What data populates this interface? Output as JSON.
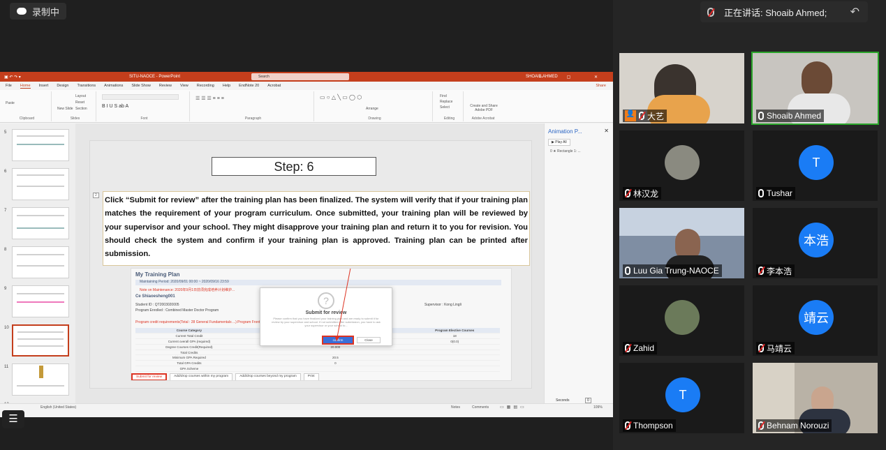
{
  "recording": {
    "label": "录制中"
  },
  "speaking": {
    "label": "正在讲话: Shoaib Ahmed;"
  },
  "ppt": {
    "title": "SITU-NAOCE - PowerPoint",
    "search": "Search",
    "user": "SHOAIB AHMED",
    "user_initials": "SA",
    "menu": [
      "File",
      "Home",
      "Insert",
      "Design",
      "Transitions",
      "Animations",
      "Slide Show",
      "Review",
      "View",
      "Recording",
      "Help",
      "EndNote 20",
      "Acrobat"
    ],
    "share": "Share",
    "ribbon_groups": [
      "Clipboard",
      "Slides",
      "Font",
      "Paragraph",
      "Drawing",
      "Editing",
      "Adobe Acrobat"
    ],
    "ribbon_items": {
      "paste": "Paste",
      "new_slide": "New Slide",
      "layout": "Layout",
      "reset": "Reset",
      "section": "Section",
      "find": "Find",
      "replace": "Replace",
      "select": "Select",
      "arrange": "Arrange",
      "adobe": "Create and Share Adobe PDF"
    },
    "thumbs": [
      {
        "num": "5"
      },
      {
        "num": "6"
      },
      {
        "num": "7"
      },
      {
        "num": "8"
      },
      {
        "num": "9"
      },
      {
        "num": "10",
        "selected": true
      },
      {
        "num": "11"
      },
      {
        "num": "12"
      }
    ],
    "slide": {
      "step": "Step: 6",
      "marker": "2",
      "paragraph": "Click “Submit for review” after the training plan has been finalized. The system will verify that if your training plan matches the requirement of your program curriculum. Once submitted, your training plan will be reviewed by your supervisor and your school. They might disapprove your training plan and return it to you for revision. You should check the system and confirm if your training plan is approved. Training plan can be printed after submission.",
      "embedded": {
        "heading": "My Training Plan",
        "maintaining": "Maintaining Period: 2020/09/01 00:00 ~ 2020/09/16 23:59",
        "note": "Note on Maintenance: 2020年9月1日前须完成培养计划维护...",
        "student": "Ce Shiaoesheng001",
        "student_id": "Student ID : QT2003020005",
        "program": "Program Enrolled : Combined Master Doctor Program",
        "supervisor": "Supervisor : Kong Lingli",
        "credit_line": "Program credit requirements(Total : 28 General Fundamentals ...) Program Frontier Courses Program Core Courses",
        "table_header": [
          "Course Category",
          "General Fundamentals",
          "",
          "Frontier Courses",
          "Program Elective Courses"
        ],
        "rows": [
          [
            "Current Total Credit",
            "1",
            "",
            "11.5",
            "18"
          ],
          [
            "Current overall GPA (required)",
            "0(0.0)",
            "",
            "0(0.0)",
            "0(0.0)"
          ],
          [
            "Degree Courses Credit(Required)",
            "",
            "20.000",
            "",
            ""
          ],
          [
            "Total Credits",
            "",
            "",
            "",
            ""
          ],
          [
            "Minimum GPA Required",
            "",
            "20.5",
            "",
            ""
          ],
          [
            "Total GPA Credits",
            "",
            "0",
            "",
            ""
          ],
          [
            "GPA Scheme",
            "",
            "",
            "",
            ""
          ]
        ],
        "dialog": {
          "title": "Submit for review",
          "text": "Please confirm that you have finalized your training plan and are ready to submit it for review by your supervisor and school. If not submitted after submission, you have to ask your supervisor or your school to...",
          "confirm": "confirm",
          "close": "Close"
        },
        "buttons": [
          "Submit for review",
          "Add/drop courses within my program",
          "Add/drop courses beyond my program",
          "Print"
        ]
      }
    },
    "animation_pane": {
      "title": "Animation P...",
      "play": "Play All",
      "item": "0 ★ Rectangle 1: ..."
    },
    "status": {
      "lang": "English (United States)",
      "notes": "Notes",
      "comments": "Comments",
      "zoom": "109%",
      "seconds": "Seconds",
      "timing": "0"
    }
  },
  "participants": [
    {
      "name": "大艺",
      "mic": "muted",
      "host": true,
      "video": true
    },
    {
      "name": "Shoaib Ahmed",
      "mic": "on",
      "video": true,
      "active": true
    },
    {
      "name": "林汉龙",
      "mic": "muted",
      "avatar_photo": true
    },
    {
      "name": "Tushar",
      "mic": "on",
      "initial": "T",
      "color": "#1a7cf5"
    },
    {
      "name": "Luu Gia Trung-NAOCE",
      "mic": "on",
      "video": true
    },
    {
      "name": "李本浩",
      "mic": "muted",
      "initial": "本浩",
      "color": "#1a7cf5"
    },
    {
      "name": "Zahid",
      "mic": "muted",
      "avatar_photo": true
    },
    {
      "name": "马靖云",
      "mic": "muted",
      "initial": "靖云",
      "color": "#1a7cf5"
    },
    {
      "name": "Thompson",
      "mic": "muted",
      "initial": "T",
      "color": "#1a7cf5"
    },
    {
      "name": "Behnam Norouzi",
      "mic": "muted",
      "video": true
    }
  ]
}
